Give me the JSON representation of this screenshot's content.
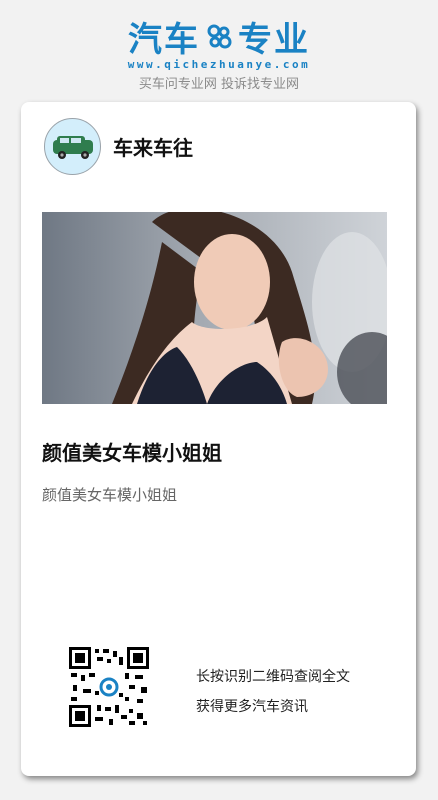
{
  "brand": {
    "logo_left": "汽车",
    "logo_right": "专业",
    "domain": "www.qichezhuanye.com",
    "slogan": "买车问专业网 投诉找专业网",
    "color": "#1a82c4"
  },
  "author": {
    "name": "车来车往",
    "avatar_icon": "car-icon"
  },
  "article": {
    "cover_icon": "photo-image",
    "title": "颜值美女车模小姐姐",
    "summary": "颜值美女车模小姐姐"
  },
  "qr": {
    "icon": "qr-code-icon",
    "hint_line1": "长按识别二维码查阅全文",
    "hint_line2": "获得更多汽车资讯"
  }
}
